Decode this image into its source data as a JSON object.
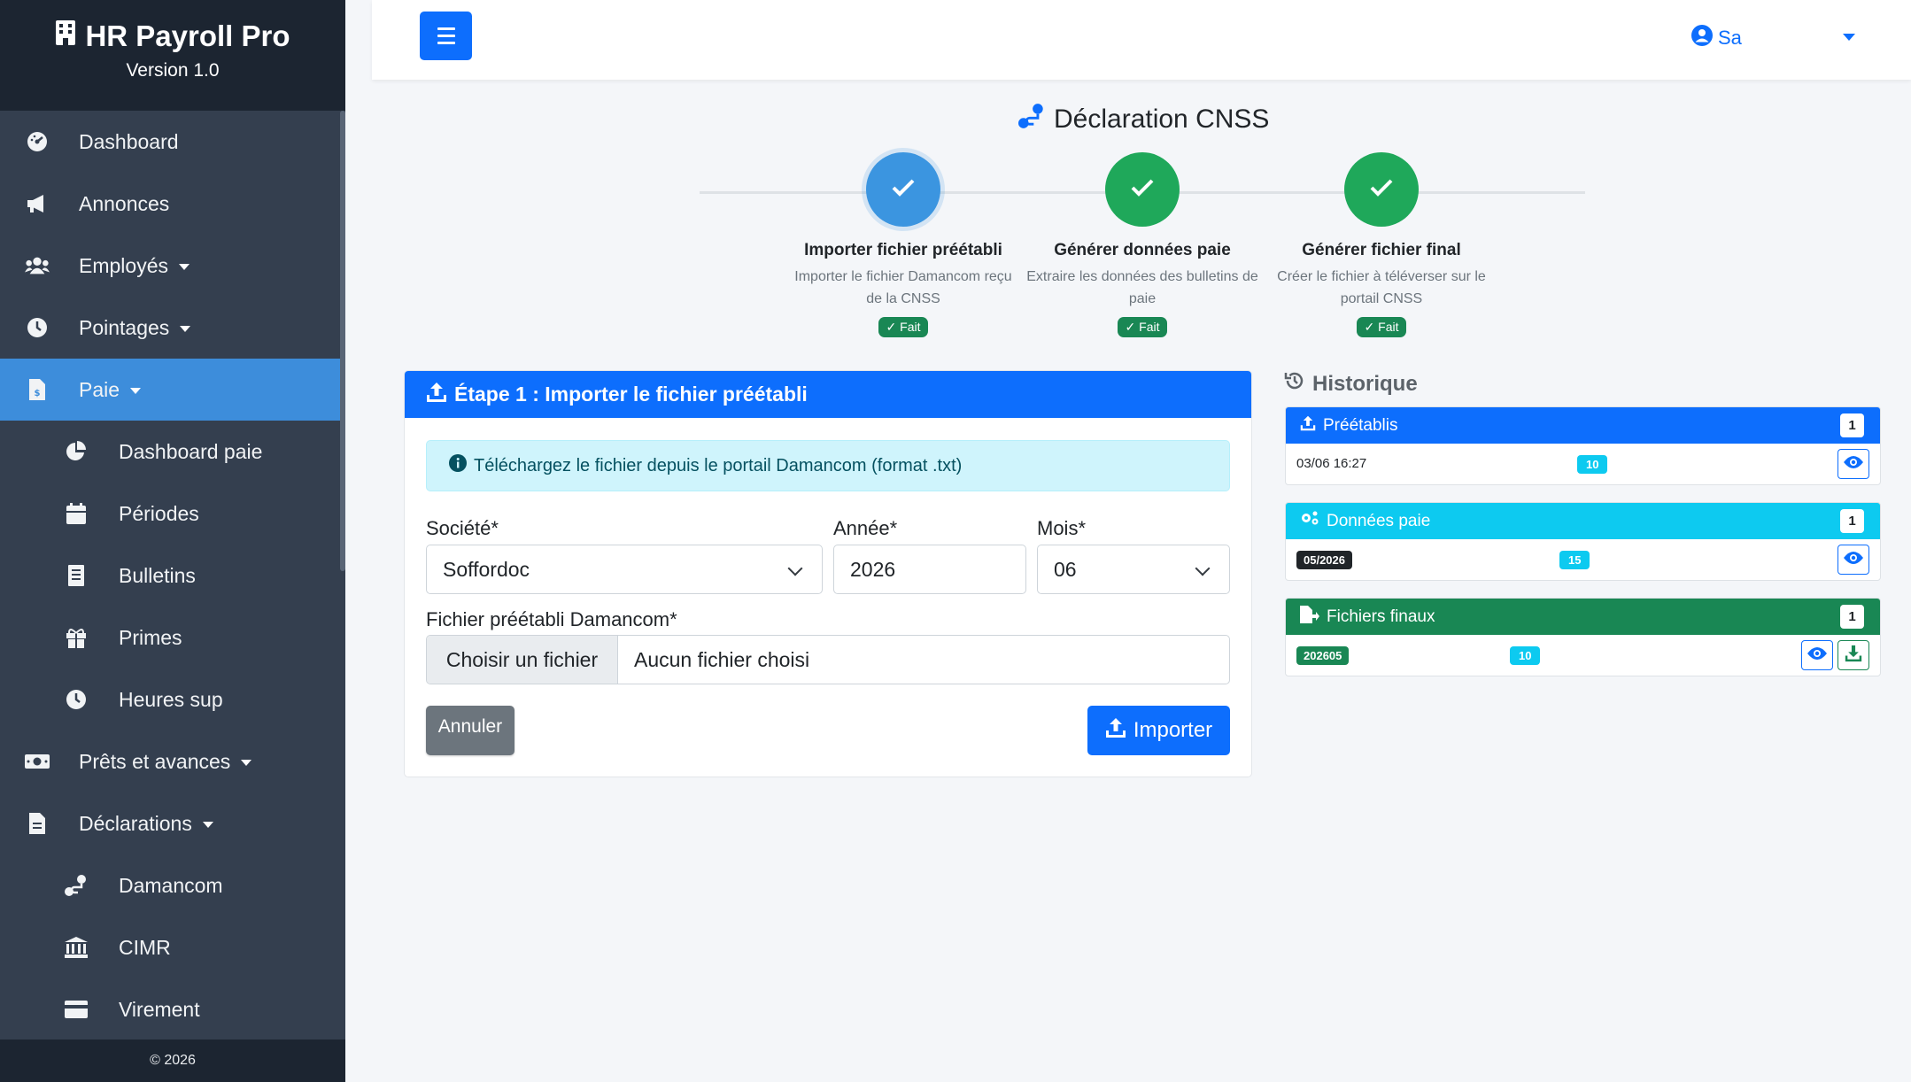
{
  "brand": {
    "title": "HR Payroll Pro",
    "version": "Version 1.0"
  },
  "sidebar": {
    "items": [
      {
        "label": "Dashboard",
        "icon": "dashboard-icon"
      },
      {
        "label": "Annonces",
        "icon": "megaphone-icon"
      },
      {
        "label": "Employés",
        "icon": "users-icon"
      },
      {
        "label": "Pointages",
        "icon": "clock-icon"
      },
      {
        "label": "Paie",
        "icon": "file-invoice-icon",
        "active": true
      },
      {
        "label": "Dashboard paie",
        "icon": "pie-chart-icon"
      },
      {
        "label": "Périodes",
        "icon": "calendar-icon"
      },
      {
        "label": "Bulletins",
        "icon": "receipt-icon"
      },
      {
        "label": "Primes",
        "icon": "gift-icon"
      },
      {
        "label": "Heures sup",
        "icon": "clock-icon"
      },
      {
        "label": "Prêts et avances",
        "icon": "money-icon"
      },
      {
        "label": "Déclarations",
        "icon": "file-icon"
      },
      {
        "label": "Damancom",
        "icon": "route-icon"
      },
      {
        "label": "CIMR",
        "icon": "bank-icon"
      },
      {
        "label": "Virement",
        "icon": "card-icon"
      }
    ],
    "footer": "© 2026"
  },
  "topbar": {
    "user": "Sa"
  },
  "page": {
    "title": "Déclaration CNSS"
  },
  "stepper": [
    {
      "title": "Importer fichier préétabli",
      "desc1": "Importer le fichier Damancom reçu",
      "desc2": "de la CNSS",
      "badge": "✓ Fait"
    },
    {
      "title": "Générer données paie",
      "desc1": "Extraire les données des bulletins de",
      "desc2": "paie",
      "badge": "✓ Fait"
    },
    {
      "title": "Générer fichier final",
      "desc1": "Créer le fichier à téléverser sur le",
      "desc2": "portail CNSS",
      "badge": "✓ Fait"
    }
  ],
  "card": {
    "title": "Étape 1 : Importer le fichier préétabli",
    "alert": "Téléchargez le fichier depuis le portail Damancom (format .txt)",
    "societe_label": "Société*",
    "societe_value": "Soffordoc",
    "annee_label": "Année*",
    "annee_value": "2026",
    "mois_label": "Mois*",
    "mois_value": "06",
    "file_label": "Fichier préétabli Damancom*",
    "file_button": "Choisir un fichier",
    "file_name": "Aucun fichier choisi",
    "cancel": "Annuler",
    "import": "Importer"
  },
  "history": {
    "title": "Historique",
    "boxes": [
      {
        "title": "Préétablis",
        "count": "1",
        "row_text": "03/06 16:27",
        "pill": "10",
        "color": "#0d6efd"
      },
      {
        "title": "Données paie",
        "count": "1",
        "row_tag": "05/2026",
        "pill": "15",
        "color": "#0dcaf0"
      },
      {
        "title": "Fichiers finaux",
        "count": "1",
        "row_tag": "202605",
        "pill": "10",
        "color": "#198754"
      }
    ]
  }
}
